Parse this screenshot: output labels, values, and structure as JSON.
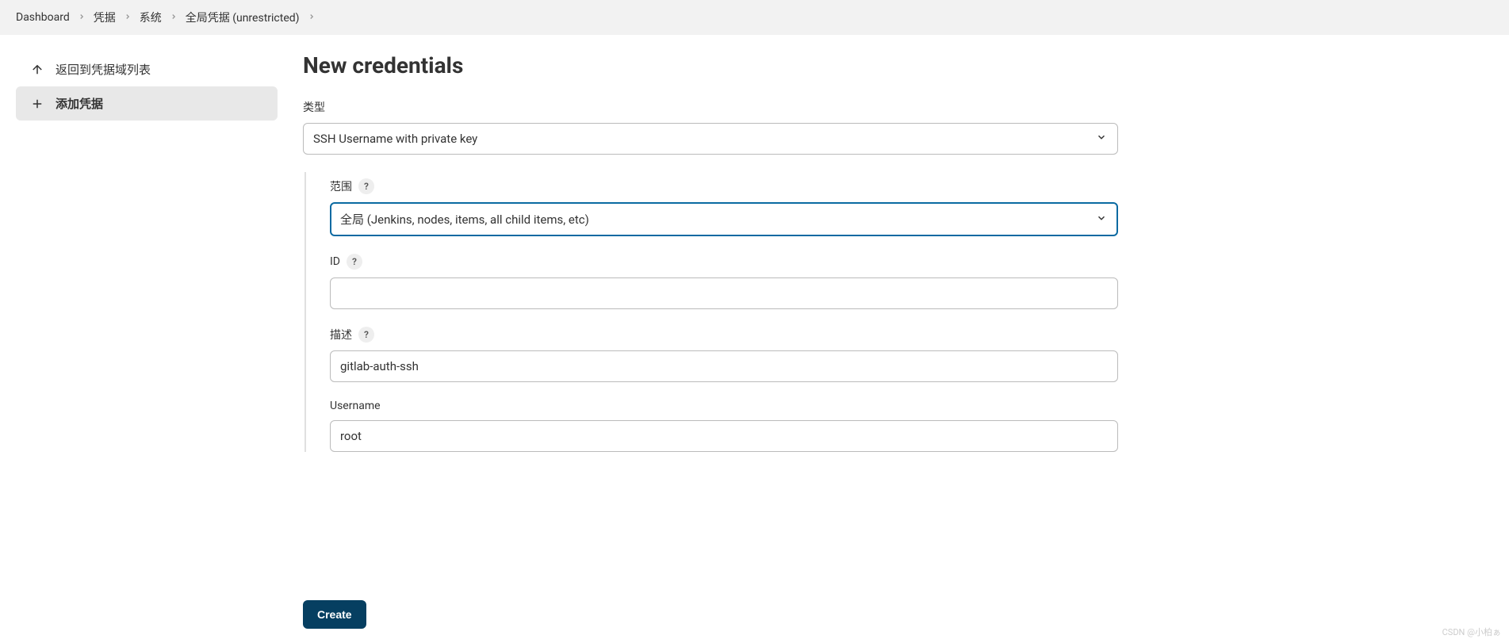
{
  "breadcrumb": {
    "items": [
      {
        "label": "Dashboard"
      },
      {
        "label": "凭据"
      },
      {
        "label": "系统"
      },
      {
        "label": "全局凭据 (unrestricted)"
      }
    ]
  },
  "sidebar": {
    "items": [
      {
        "label": "返回到凭据域列表",
        "icon": "arrow-up"
      },
      {
        "label": "添加凭据",
        "icon": "plus",
        "active": true
      }
    ]
  },
  "main": {
    "title": "New credentials",
    "type_label": "类型",
    "type_value": "SSH Username with private key",
    "scope_label": "范围",
    "scope_value": "全局 (Jenkins, nodes, items, all child items, etc)",
    "id_label": "ID",
    "id_value": "",
    "desc_label": "描述",
    "desc_value": "gitlab-auth-ssh",
    "username_label": "Username",
    "username_value": "root",
    "create_label": "Create",
    "help_char": "?"
  },
  "watermark": "CSDN @小柏ぁ"
}
